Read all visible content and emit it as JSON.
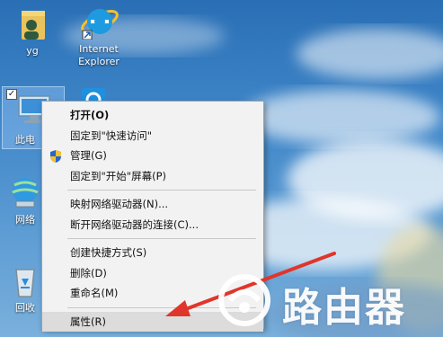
{
  "desktop": {
    "icons": [
      {
        "label": "yg",
        "icon": "user-folder-icon"
      },
      {
        "label": "Internet\nExplorer",
        "icon": "internet-explorer-icon"
      },
      {
        "label": "此电",
        "icon": "this-pc-icon",
        "selected": true
      },
      {
        "label": "网络",
        "icon": "network-icon"
      },
      {
        "label": "回收",
        "icon": "recycle-bin-icon"
      }
    ],
    "partial_icon": "blue-app-icon"
  },
  "context_menu": {
    "groups": [
      [
        {
          "label": "打开(O)",
          "bold": true
        },
        {
          "label": "固定到\"快速访问\""
        },
        {
          "label": "管理(G)",
          "icon": "shield-icon"
        },
        {
          "label": "固定到\"开始\"屏幕(P)"
        }
      ],
      [
        {
          "label": "映射网络驱动器(N)..."
        },
        {
          "label": "断开网络驱动器的连接(C)..."
        }
      ],
      [
        {
          "label": "创建快捷方式(S)"
        },
        {
          "label": "删除(D)"
        },
        {
          "label": "重命名(M)"
        }
      ],
      [
        {
          "label": "属性(R)",
          "highlighted": true
        }
      ]
    ]
  },
  "watermark": {
    "text": "路由器"
  },
  "colors": {
    "arrow": "#e0352b",
    "menu_bg": "#f2f2f2"
  }
}
